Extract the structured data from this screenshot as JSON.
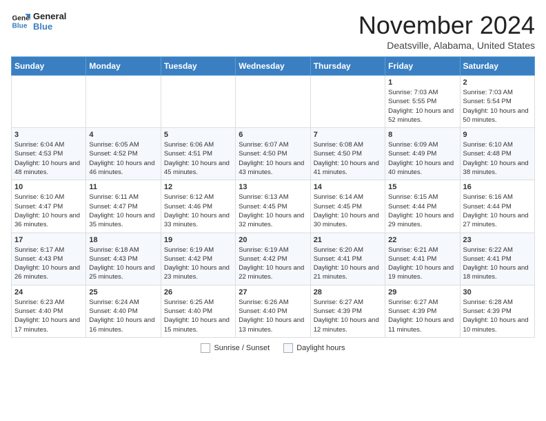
{
  "logo": {
    "line1": "General",
    "line2": "Blue"
  },
  "title": "November 2024",
  "location": "Deatsville, Alabama, United States",
  "weekdays": [
    "Sunday",
    "Monday",
    "Tuesday",
    "Wednesday",
    "Thursday",
    "Friday",
    "Saturday"
  ],
  "weeks": [
    [
      {
        "day": "",
        "info": ""
      },
      {
        "day": "",
        "info": ""
      },
      {
        "day": "",
        "info": ""
      },
      {
        "day": "",
        "info": ""
      },
      {
        "day": "",
        "info": ""
      },
      {
        "day": "1",
        "info": "Sunrise: 7:03 AM\nSunset: 5:55 PM\nDaylight: 10 hours and 52 minutes."
      },
      {
        "day": "2",
        "info": "Sunrise: 7:03 AM\nSunset: 5:54 PM\nDaylight: 10 hours and 50 minutes."
      }
    ],
    [
      {
        "day": "3",
        "info": "Sunrise: 6:04 AM\nSunset: 4:53 PM\nDaylight: 10 hours and 48 minutes."
      },
      {
        "day": "4",
        "info": "Sunrise: 6:05 AM\nSunset: 4:52 PM\nDaylight: 10 hours and 46 minutes."
      },
      {
        "day": "5",
        "info": "Sunrise: 6:06 AM\nSunset: 4:51 PM\nDaylight: 10 hours and 45 minutes."
      },
      {
        "day": "6",
        "info": "Sunrise: 6:07 AM\nSunset: 4:50 PM\nDaylight: 10 hours and 43 minutes."
      },
      {
        "day": "7",
        "info": "Sunrise: 6:08 AM\nSunset: 4:50 PM\nDaylight: 10 hours and 41 minutes."
      },
      {
        "day": "8",
        "info": "Sunrise: 6:09 AM\nSunset: 4:49 PM\nDaylight: 10 hours and 40 minutes."
      },
      {
        "day": "9",
        "info": "Sunrise: 6:10 AM\nSunset: 4:48 PM\nDaylight: 10 hours and 38 minutes."
      }
    ],
    [
      {
        "day": "10",
        "info": "Sunrise: 6:10 AM\nSunset: 4:47 PM\nDaylight: 10 hours and 36 minutes."
      },
      {
        "day": "11",
        "info": "Sunrise: 6:11 AM\nSunset: 4:47 PM\nDaylight: 10 hours and 35 minutes."
      },
      {
        "day": "12",
        "info": "Sunrise: 6:12 AM\nSunset: 4:46 PM\nDaylight: 10 hours and 33 minutes."
      },
      {
        "day": "13",
        "info": "Sunrise: 6:13 AM\nSunset: 4:45 PM\nDaylight: 10 hours and 32 minutes."
      },
      {
        "day": "14",
        "info": "Sunrise: 6:14 AM\nSunset: 4:45 PM\nDaylight: 10 hours and 30 minutes."
      },
      {
        "day": "15",
        "info": "Sunrise: 6:15 AM\nSunset: 4:44 PM\nDaylight: 10 hours and 29 minutes."
      },
      {
        "day": "16",
        "info": "Sunrise: 6:16 AM\nSunset: 4:44 PM\nDaylight: 10 hours and 27 minutes."
      }
    ],
    [
      {
        "day": "17",
        "info": "Sunrise: 6:17 AM\nSunset: 4:43 PM\nDaylight: 10 hours and 26 minutes."
      },
      {
        "day": "18",
        "info": "Sunrise: 6:18 AM\nSunset: 4:43 PM\nDaylight: 10 hours and 25 minutes."
      },
      {
        "day": "19",
        "info": "Sunrise: 6:19 AM\nSunset: 4:42 PM\nDaylight: 10 hours and 23 minutes."
      },
      {
        "day": "20",
        "info": "Sunrise: 6:19 AM\nSunset: 4:42 PM\nDaylight: 10 hours and 22 minutes."
      },
      {
        "day": "21",
        "info": "Sunrise: 6:20 AM\nSunset: 4:41 PM\nDaylight: 10 hours and 21 minutes."
      },
      {
        "day": "22",
        "info": "Sunrise: 6:21 AM\nSunset: 4:41 PM\nDaylight: 10 hours and 19 minutes."
      },
      {
        "day": "23",
        "info": "Sunrise: 6:22 AM\nSunset: 4:41 PM\nDaylight: 10 hours and 18 minutes."
      }
    ],
    [
      {
        "day": "24",
        "info": "Sunrise: 6:23 AM\nSunset: 4:40 PM\nDaylight: 10 hours and 17 minutes."
      },
      {
        "day": "25",
        "info": "Sunrise: 6:24 AM\nSunset: 4:40 PM\nDaylight: 10 hours and 16 minutes."
      },
      {
        "day": "26",
        "info": "Sunrise: 6:25 AM\nSunset: 4:40 PM\nDaylight: 10 hours and 15 minutes."
      },
      {
        "day": "27",
        "info": "Sunrise: 6:26 AM\nSunset: 4:40 PM\nDaylight: 10 hours and 13 minutes."
      },
      {
        "day": "28",
        "info": "Sunrise: 6:27 AM\nSunset: 4:39 PM\nDaylight: 10 hours and 12 minutes."
      },
      {
        "day": "29",
        "info": "Sunrise: 6:27 AM\nSunset: 4:39 PM\nDaylight: 10 hours and 11 minutes."
      },
      {
        "day": "30",
        "info": "Sunrise: 6:28 AM\nSunset: 4:39 PM\nDaylight: 10 hours and 10 minutes."
      }
    ]
  ],
  "legend": {
    "sunrise_label": "Sunrise / Sunset",
    "daylight_label": "Daylight hours"
  }
}
